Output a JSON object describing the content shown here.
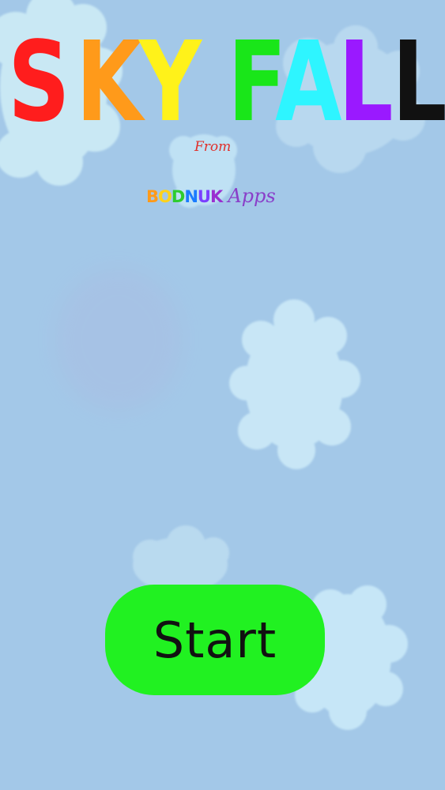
{
  "game": {
    "title_letters": [
      {
        "char": "S",
        "color": "#ff1d1d"
      },
      {
        "char": "K",
        "color": "#ff9a1a"
      },
      {
        "char": "Y",
        "color": "#fff21a"
      },
      {
        "char": "F",
        "color": "#19e619"
      },
      {
        "char": "A",
        "color": "#2ef5ff"
      },
      {
        "char": "L",
        "color": "#9a19ff"
      },
      {
        "char": "L",
        "color": "#111111"
      }
    ],
    "from_label": "From",
    "brand_letters": [
      {
        "char": "B",
        "color": "#ff9a1a"
      },
      {
        "char": "O",
        "color": "#ffd21a"
      },
      {
        "char": "D",
        "color": "#2ecc2e"
      },
      {
        "char": "N",
        "color": "#1a7bff"
      },
      {
        "char": "U",
        "color": "#7a3fff"
      },
      {
        "char": "K",
        "color": "#9a2fd0"
      }
    ],
    "brand_suffix": "Apps",
    "start_button_label": "Start"
  },
  "colors": {
    "sky": "#a3c8e8",
    "cloud": "#c7e6f4",
    "start_button": "#21f121"
  }
}
